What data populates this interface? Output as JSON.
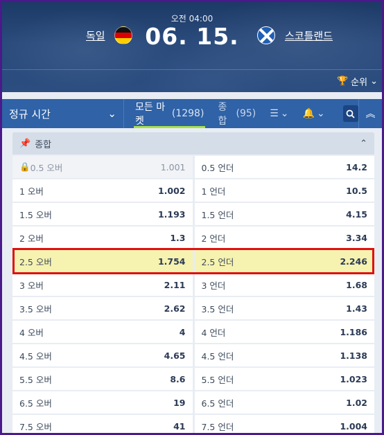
{
  "header": {
    "time": "오전 04:00",
    "date": "06. 15.",
    "home_team": "독일",
    "away_team": "스코틀랜드",
    "ranking_label": "순위"
  },
  "tabs": {
    "period": "정규 시간",
    "all_markets": "모든 마켓",
    "all_markets_count": "(1298)",
    "combined": "종합",
    "combined_count": "(95)"
  },
  "market": {
    "title": "종합",
    "rows": [
      {
        "over_label": "0.5 오버",
        "over_odds": "1.001",
        "under_label": "0.5 언더",
        "under_odds": "14.2",
        "locked": true
      },
      {
        "over_label": "1 오버",
        "over_odds": "1.002",
        "under_label": "1 언더",
        "under_odds": "10.5"
      },
      {
        "over_label": "1.5 오버",
        "over_odds": "1.193",
        "under_label": "1.5 언더",
        "under_odds": "4.15"
      },
      {
        "over_label": "2 오버",
        "over_odds": "1.3",
        "under_label": "2 언더",
        "under_odds": "3.34"
      },
      {
        "over_label": "2.5 오버",
        "over_odds": "1.754",
        "under_label": "2.5 언더",
        "under_odds": "2.246",
        "highlighted": true
      },
      {
        "over_label": "3 오버",
        "over_odds": "2.11",
        "under_label": "3 언더",
        "under_odds": "1.68"
      },
      {
        "over_label": "3.5 오버",
        "over_odds": "2.62",
        "under_label": "3.5 언더",
        "under_odds": "1.43"
      },
      {
        "over_label": "4 오버",
        "over_odds": "4",
        "under_label": "4 언더",
        "under_odds": "1.186"
      },
      {
        "over_label": "4.5 오버",
        "over_odds": "4.65",
        "under_label": "4.5 언더",
        "under_odds": "1.138"
      },
      {
        "over_label": "5.5 오버",
        "over_odds": "8.6",
        "under_label": "5.5 언더",
        "under_odds": "1.023"
      },
      {
        "over_label": "6.5 오버",
        "over_odds": "19",
        "under_label": "6.5 언더",
        "under_odds": "1.02"
      },
      {
        "over_label": "7.5 오버",
        "over_odds": "41",
        "under_label": "7.5 언더",
        "under_odds": "1.004"
      }
    ]
  },
  "colors": {
    "accent_underline": "#a7e24a",
    "tab_bar": "#2f62a6",
    "highlight_row": "#f6f2b0",
    "highlight_border": "#e01010"
  }
}
